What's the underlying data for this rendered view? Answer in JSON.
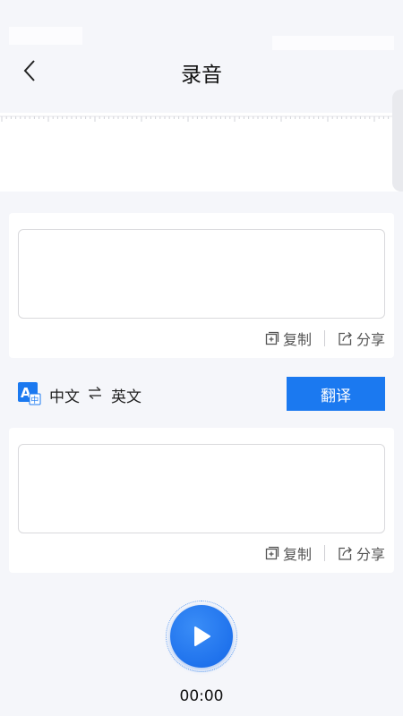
{
  "header": {
    "title": "录音",
    "back_icon": "chevron-left-icon"
  },
  "card_source": {
    "value": "",
    "copy_label": "复制",
    "share_label": "分享"
  },
  "card_target": {
    "value": "",
    "copy_label": "复制",
    "share_label": "分享"
  },
  "language": {
    "source": "中文",
    "target": "英文",
    "translate_label": "翻译",
    "icon": "translate-icon",
    "swap_icon": "swap-icon"
  },
  "player": {
    "time": "00:00",
    "play_icon": "play-icon"
  },
  "colors": {
    "accent": "#1b79f0",
    "background": "#f5f6fa"
  }
}
